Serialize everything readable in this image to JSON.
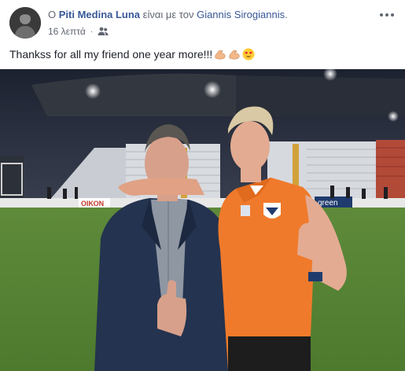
{
  "post": {
    "prefix": "Ο",
    "author": "Piti Medina Luna",
    "with_text": "είναι με τον",
    "tagged": "Giannis Sirogiannis",
    "tagged_suffix": ".",
    "time": "16 λεπτά",
    "separator": "·",
    "privacy_icon": "friends-icon",
    "menu_icon": "more-options-icon",
    "message": "Thankss for all my friend one year more!!!",
    "emojis": [
      "flexed-biceps-emoji",
      "flexed-biceps-emoji",
      "heart-eyes-emoji"
    ],
    "photo": {
      "description_icon": "stadium-photo",
      "sponsor_left": "ΟΙΚΟΝ",
      "sponsor_right": "green"
    }
  },
  "colors": {
    "link": "#385898",
    "text": "#1d2129",
    "meta": "#616770",
    "jersey": "#f07a2b"
  }
}
